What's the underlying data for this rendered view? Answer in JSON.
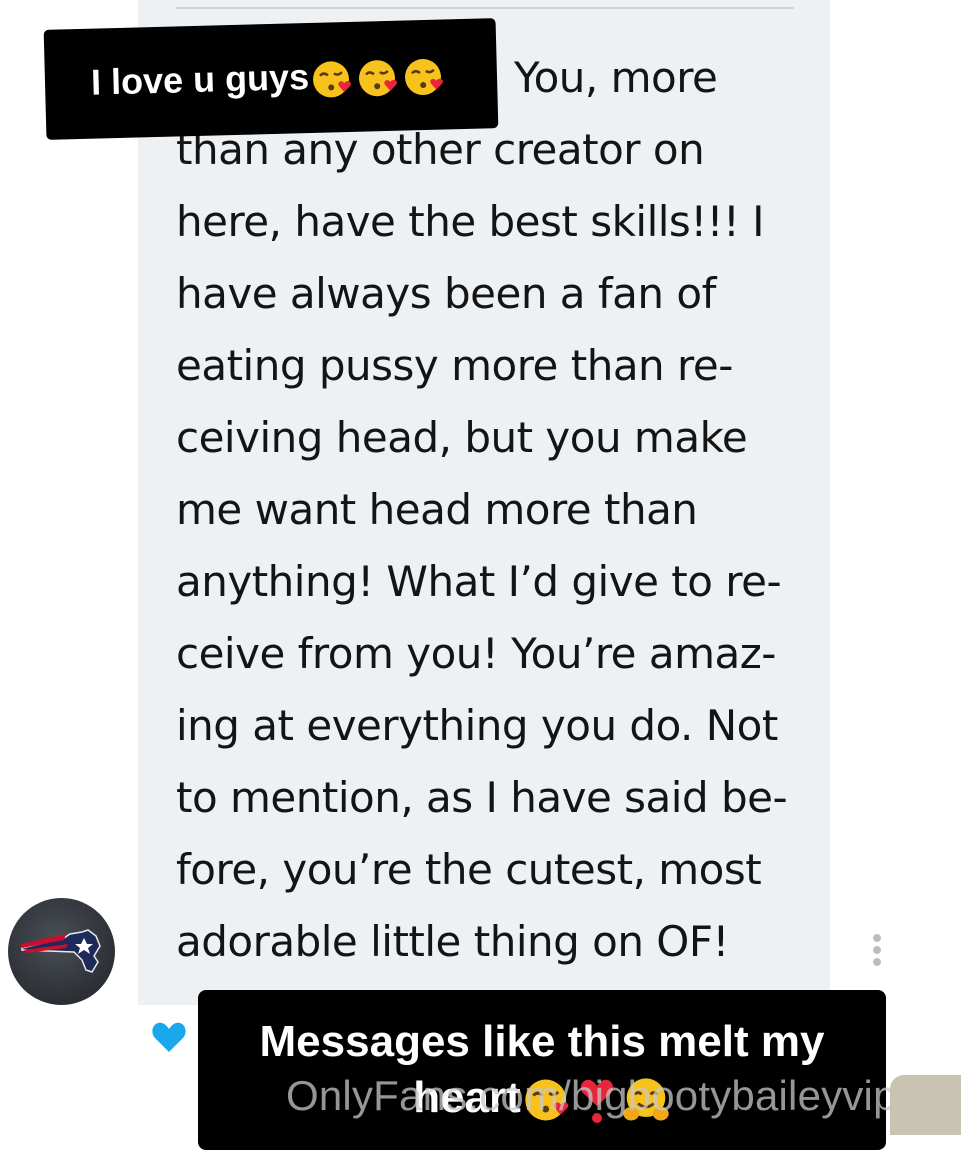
{
  "caption_top": {
    "text": "I love u guys"
  },
  "message": {
    "lines": [
      "You, more",
      "than any other creator on",
      "here, have the best skills!!! I",
      "have always been a fan of",
      "eating pussy more than re-",
      "ceiving head, but you make",
      "me want head more than",
      "anything! What I’d give to re-",
      "ceive from you! You’re amaz-",
      "ing at everything you do. Not",
      "to mention, as I have said be-",
      "fore, you’re the cutest, most",
      "adorable little thing on OF!"
    ]
  },
  "caption_bottom": {
    "line1": "Messages like this melt my",
    "line2": "heart"
  },
  "watermark": {
    "text": "OnlyFans.com/bigbootybaileyvip"
  },
  "icons": {
    "avatar": "patriots-logo-avatar",
    "options": "kebab-menu-icon",
    "like": "heart-icon",
    "emoji_kiss": "face-blowing-kiss-emoji",
    "emoji_heart": "heart-exclamation-emoji",
    "emoji_hug": "hugging-face-emoji"
  },
  "colors": {
    "bubble_bg": "#eef1f3",
    "like_blue": "#1aa7ec",
    "caption_bg": "#000000",
    "caption_text": "#ffffff"
  }
}
